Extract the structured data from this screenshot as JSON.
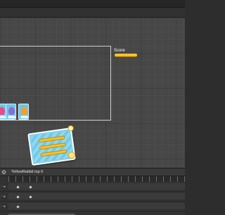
{
  "scene": {
    "score_label": "Score",
    "accent_color": "#f5c329",
    "panel_color": "#7fd1ec"
  },
  "timeline": {
    "settings_icon": "gear-icon",
    "clip_name": "YellowRabbit top 0"
  }
}
